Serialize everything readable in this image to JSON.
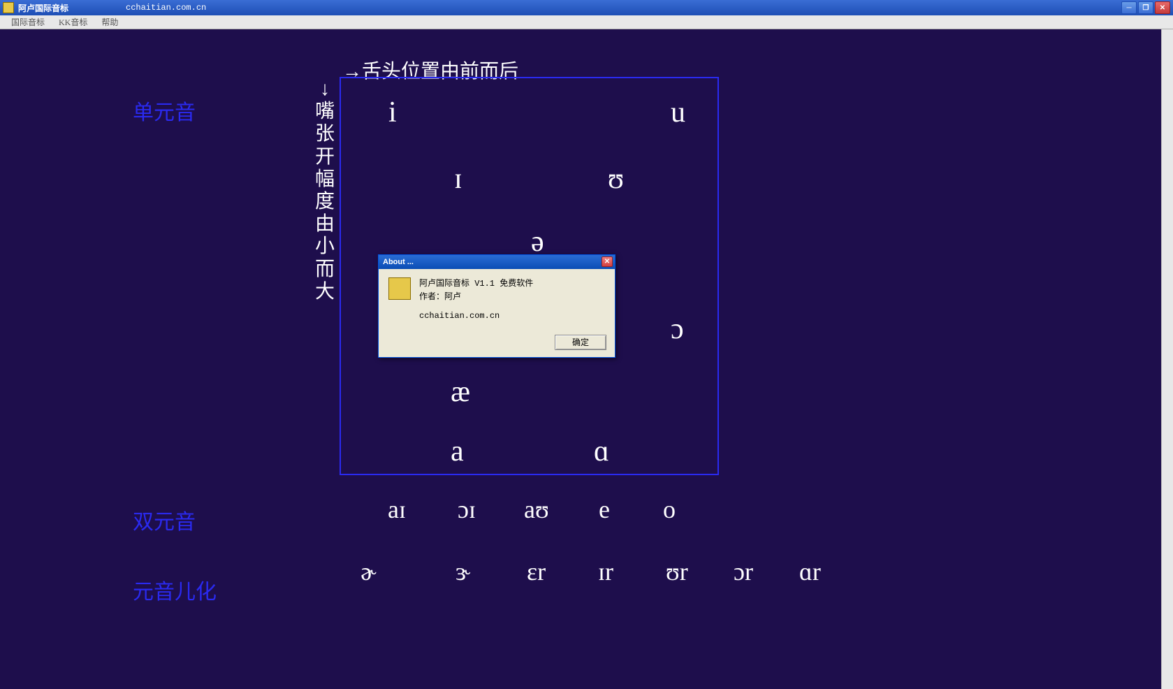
{
  "window": {
    "title": "阿卢国际音标",
    "url": "cchaitian.com.cn"
  },
  "menu": {
    "item1": "国际音标",
    "item2": "KK音标",
    "item3": "帮助"
  },
  "labels": {
    "top": "→舌头位置由前而后",
    "left": "↓嘴张开幅度由小而大",
    "section1": "单元音",
    "section2": "双元音",
    "section3": "元音儿化"
  },
  "vowels": {
    "i": "i",
    "u": "u",
    "I": "ɪ",
    "U": "ʊ",
    "schwa": "ə",
    "open_o": "ɔ",
    "ae": "æ",
    "a": "a",
    "back_a": "ɑ"
  },
  "diphthongs": {
    "d1": "aɪ",
    "d2": "ɔɪ",
    "d3": "aʊ",
    "d4": "e",
    "d5": "o"
  },
  "rcolored": {
    "r0": "ɚ",
    "r1": "ɝ",
    "r2": "ɛr",
    "r3": "ɪr",
    "r4": "ʊr",
    "r5": "ɔr",
    "r6": "ɑr"
  },
  "dialog": {
    "title": "About ...",
    "line1": "阿卢国际音标 V1.1  免费软件",
    "line2": "作者：阿卢",
    "line3": "cchaitian.com.cn",
    "ok": "确定"
  }
}
